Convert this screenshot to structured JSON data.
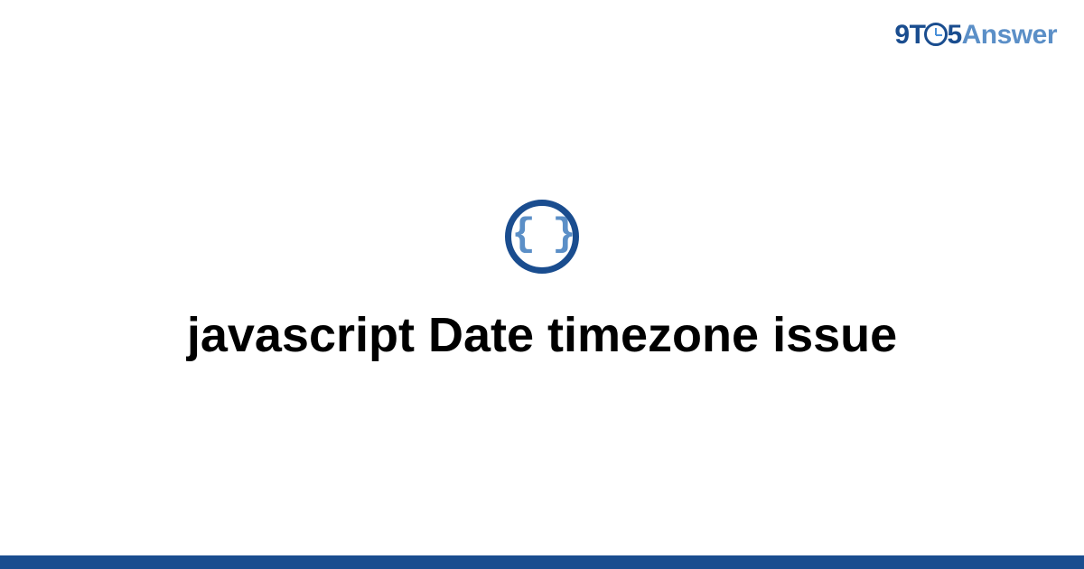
{
  "brand": {
    "part1": "9T",
    "part2": "5",
    "part3": "Answer"
  },
  "icon": {
    "glyph": "{ }"
  },
  "title": "javascript Date timezone issue",
  "colors": {
    "primary": "#1a4d8f",
    "accent": "#5b8fc7"
  }
}
